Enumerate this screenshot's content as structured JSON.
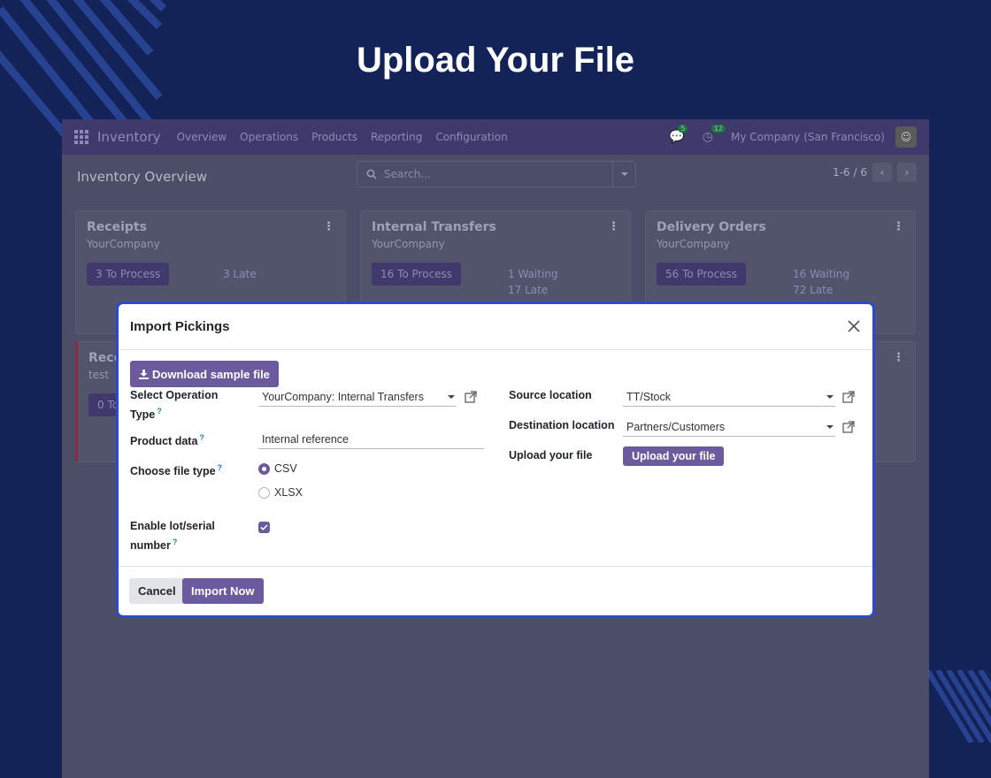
{
  "hero": {
    "title": "Upload Your File"
  },
  "navbar": {
    "brand": "Inventory",
    "items": [
      "Overview",
      "Operations",
      "Products",
      "Reporting",
      "Configuration"
    ],
    "messages_count": "5",
    "activities_count": "12",
    "company": "My Company (San Francisco)"
  },
  "control": {
    "breadcrumb": "Inventory Overview",
    "search_placeholder": "Search...",
    "pager": "1-6 / 6"
  },
  "cards": [
    {
      "title": "Receipts",
      "sub": "YourCompany",
      "button": "3 To Process",
      "meta1": "3 Late",
      "meta2": ""
    },
    {
      "title": "Internal Transfers",
      "sub": "YourCompany",
      "button": "16 To Process",
      "meta1": "1 Waiting",
      "meta2": "17 Late"
    },
    {
      "title": "Delivery Orders",
      "sub": "YourCompany",
      "button": "56 To Process",
      "meta1": "16 Waiting",
      "meta2": "72 Late"
    },
    {
      "title": "Rece",
      "sub": "test",
      "button": "0 To",
      "meta1": "",
      "meta2": ""
    }
  ],
  "modal": {
    "title": "Import Pickings",
    "download_label": "Download sample file",
    "operation_type_label": "Select Operation Type",
    "operation_type_value": "YourCompany: Internal Transfers",
    "product_data_label": "Product data",
    "product_data_value": "Internal reference",
    "file_type_label": "Choose file type",
    "file_type_options": [
      "CSV",
      "XLSX"
    ],
    "lot_label": "Enable lot/serial number",
    "source_label": "Source location",
    "source_value": "TT/Stock",
    "dest_label": "Destination location",
    "dest_value": "Partners/Customers",
    "upload_label": "Upload your file",
    "upload_button": "Upload your file",
    "help_mark": "?",
    "cancel_label": "Cancel",
    "import_label": "Import Now"
  }
}
